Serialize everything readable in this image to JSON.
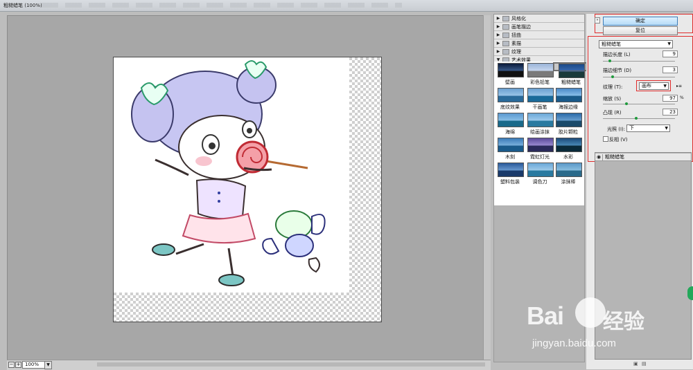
{
  "window": {
    "title": "粗糙蜡笔 (100%)"
  },
  "preview": {
    "zoom": "100%"
  },
  "gallery": {
    "categories": [
      {
        "label": "风格化",
        "expanded": false
      },
      {
        "label": "画笔描边",
        "expanded": false
      },
      {
        "label": "扭曲",
        "expanded": false
      },
      {
        "label": "素描",
        "expanded": false
      },
      {
        "label": "纹理",
        "expanded": false
      },
      {
        "label": "艺术效果",
        "expanded": true
      }
    ],
    "thumbnails": [
      {
        "label": "壁画"
      },
      {
        "label": "彩色铅笔"
      },
      {
        "label": "粗糙蜡笔"
      },
      {
        "label": "底纹效果"
      },
      {
        "label": "干画笔"
      },
      {
        "label": "海报边缘"
      },
      {
        "label": "海绵"
      },
      {
        "label": "绘画涂抹"
      },
      {
        "label": "胶片颗粒"
      },
      {
        "label": "木刻"
      },
      {
        "label": "霓虹灯光"
      },
      {
        "label": "水彩"
      },
      {
        "label": "塑料包装"
      },
      {
        "label": "调色刀"
      },
      {
        "label": "涂抹棒"
      }
    ],
    "selected": "粗糙蜡笔"
  },
  "buttons": {
    "ok": "确定",
    "reset": "复位"
  },
  "settings": {
    "filter": "粗糙蜡笔",
    "stroke_length": {
      "label": "描边长度 (L)",
      "value": "9"
    },
    "stroke_detail": {
      "label": "描边细节 (D)",
      "value": "3"
    },
    "texture": {
      "label": "纹理 (T):",
      "value": "画布"
    },
    "scaling": {
      "label": "缩放 (S)",
      "value": "97",
      "unit": "%"
    },
    "relief": {
      "label": "凸现 (R)",
      "value": "23"
    },
    "light": {
      "label": "光照 (I):",
      "value": "下"
    },
    "invert": {
      "label": "反相 (V)",
      "checked": false
    }
  },
  "layers": {
    "items": [
      {
        "label": "粗糙蜡笔"
      }
    ]
  },
  "watermark": {
    "brand": "Bai",
    "brand_cn": "经验",
    "url": "jingyan.baidu.com"
  },
  "colors": {
    "ok_button": "#b6dcf7",
    "highlight_box": "#e02b2b",
    "slider_knob": "#1e9a3c"
  }
}
